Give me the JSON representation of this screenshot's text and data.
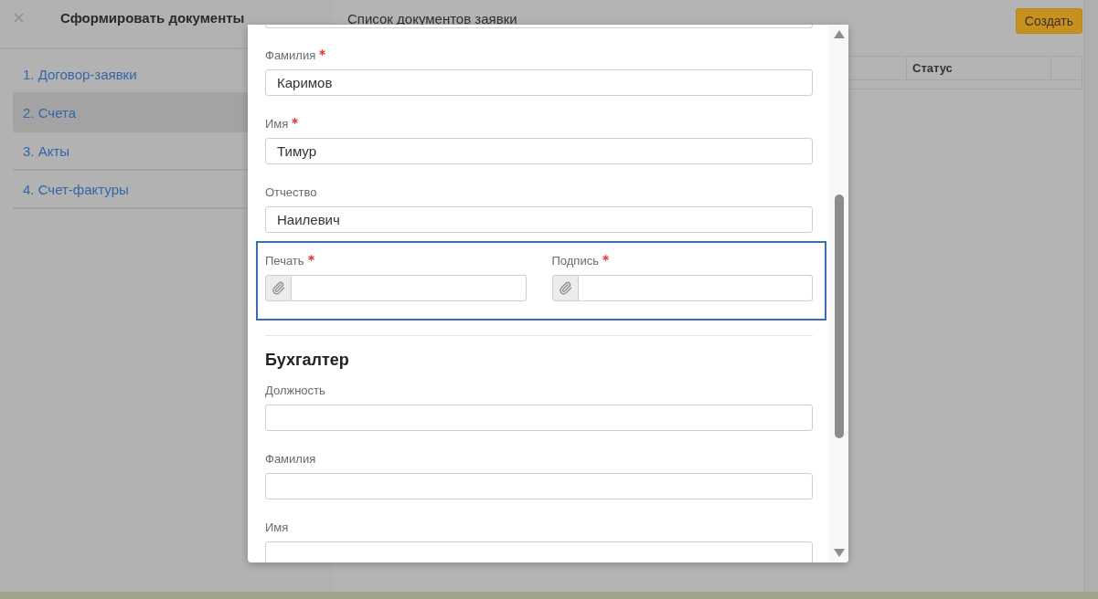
{
  "sidebar": {
    "title": "Сформировать документы",
    "items": [
      {
        "label": "1. Договор-заявки",
        "selected": false
      },
      {
        "label": "2. Счета",
        "selected": true
      },
      {
        "label": "3. Акты",
        "selected": false
      },
      {
        "label": "4. Счет-фактуры",
        "selected": false
      }
    ]
  },
  "main": {
    "title": "Список документов заявки",
    "create_button": "Создать",
    "table": {
      "columns": [
        {
          "label": "Статус"
        }
      ]
    }
  },
  "modal": {
    "sections": [
      {
        "fields": [
          {
            "label": "Фамилия",
            "required": true,
            "value": "Каримов"
          },
          {
            "label": "Имя",
            "required": true,
            "value": "Тимур"
          },
          {
            "label": "Отчество",
            "required": false,
            "value": "Наилевич"
          }
        ],
        "file_group": {
          "highlighted": true,
          "fields": [
            {
              "label": "Печать",
              "required": true
            },
            {
              "label": "Подпись",
              "required": true
            }
          ]
        }
      },
      {
        "title": "Бухгалтер",
        "fields": [
          {
            "label": "Должность",
            "required": false
          },
          {
            "label": "Фамилия",
            "required": false
          },
          {
            "label": "Имя",
            "required": false
          }
        ]
      }
    ]
  }
}
